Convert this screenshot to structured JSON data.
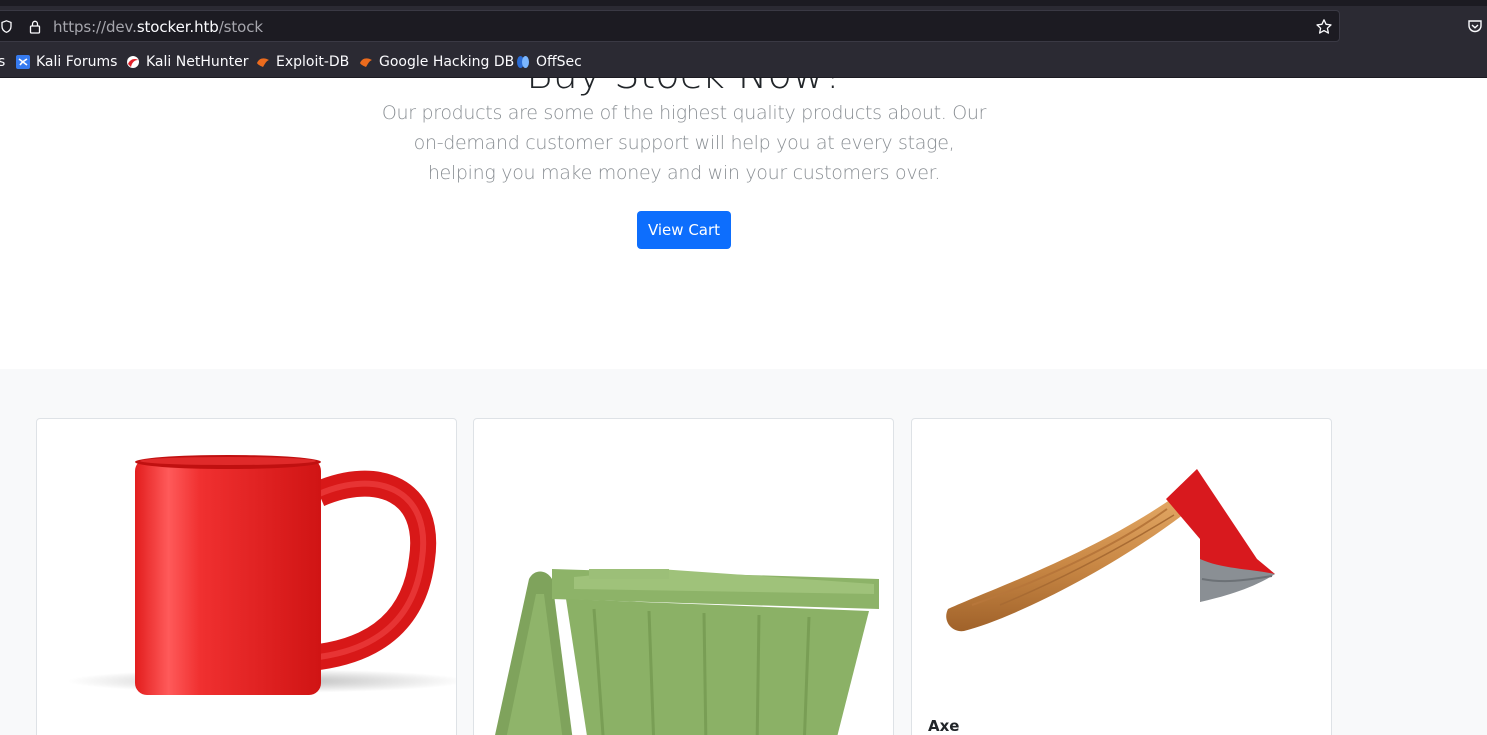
{
  "browser": {
    "url_prefix": "https://dev.",
    "url_host": "stocker.htb",
    "url_path": "/stock",
    "bookmarks": [
      {
        "label": "s",
        "icon": "none"
      },
      {
        "label": "Kali Forums",
        "icon": "kali-forums-icon"
      },
      {
        "label": "Kali NetHunter",
        "icon": "kali-nethunter-icon"
      },
      {
        "label": "Exploit-DB",
        "icon": "exploit-db-icon"
      },
      {
        "label": "Google Hacking DB",
        "icon": "ghdb-icon"
      },
      {
        "label": "OffSec",
        "icon": "offsec-icon"
      }
    ]
  },
  "hero": {
    "heading": "Buy Stock Now!",
    "text": "Our products are some of the highest quality products about. Our on-demand customer support will help you at every stage, helping you make money and win your customers over.",
    "button_label": "View Cart"
  },
  "products": [
    {
      "name": "",
      "image": "red-mug"
    },
    {
      "name": "",
      "image": "green-bin"
    },
    {
      "name": "Axe",
      "image": "axe"
    }
  ],
  "colors": {
    "primary": "#0d6efd",
    "section_bg": "#f8f9fa",
    "chrome_bg": "#2b2a33"
  }
}
